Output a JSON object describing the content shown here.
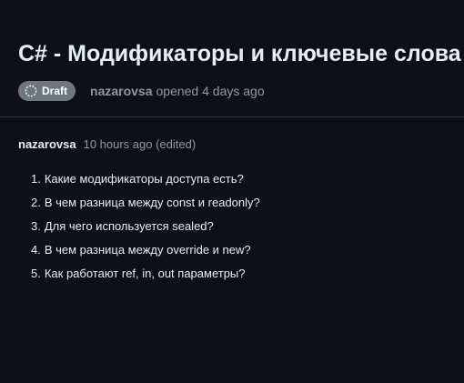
{
  "issue": {
    "title": "C# - Модификаторы и ключевые слова",
    "state_badge": "Draft",
    "author": "nazarovsa",
    "opened_text": "opened 4 days ago"
  },
  "comment": {
    "author": "nazarovsa",
    "time_text": "10 hours ago (edited)",
    "items": [
      {
        "num": "1.",
        "text": "Какие модификаторы доступа есть?"
      },
      {
        "num": "2.",
        "text": "В чем разница между const и readonly?"
      },
      {
        "num": "3.",
        "text": "Для чего используется sealed?"
      },
      {
        "num": "4.",
        "text": "В чем разница между override и new?"
      },
      {
        "num": "5.",
        "text": "Как работают ref, in, out параметры?"
      }
    ]
  },
  "colors": {
    "background": "#0d1117",
    "badge": "#6e7681",
    "muted_text": "#9198a1",
    "divider": "#30363d"
  },
  "icons": {
    "draft": "draft-dashed-circle-icon"
  }
}
